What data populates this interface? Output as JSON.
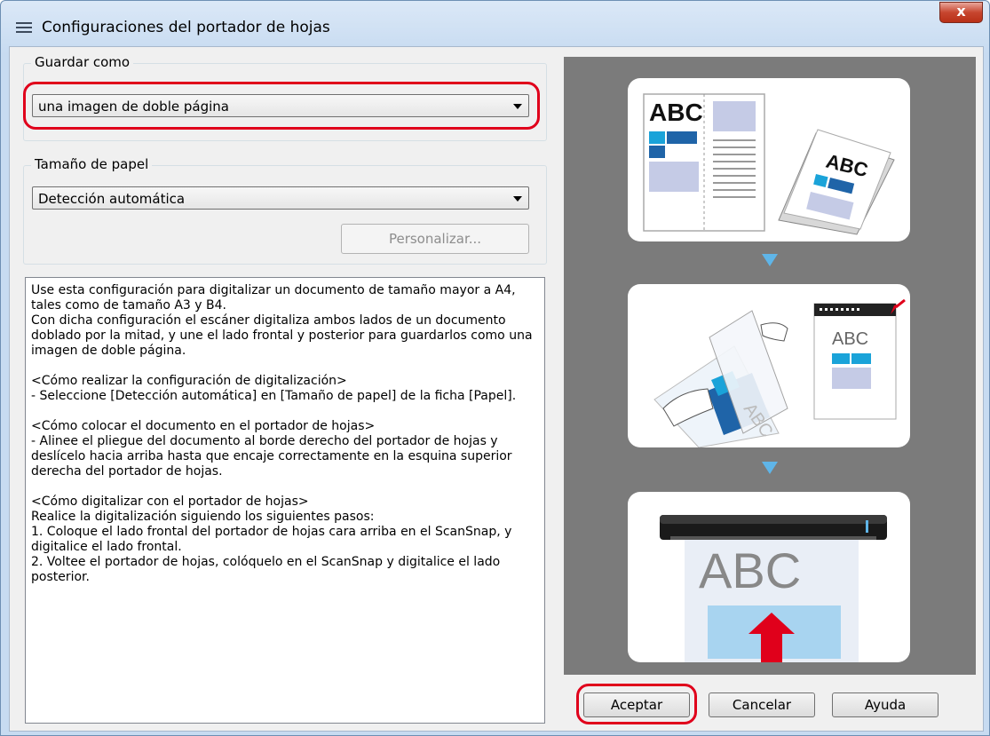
{
  "window": {
    "title": "Configuraciones del portador de hojas",
    "close_label": "x"
  },
  "save_as": {
    "label": "Guardar como",
    "selected": "una imagen de doble página"
  },
  "paper_size": {
    "label": "Tamaño de papel",
    "selected": "Detección automática",
    "customize_label": "Personalizar..."
  },
  "description": "Use esta configuración para digitalizar un documento de tamaño mayor a A4, tales como de tamaño A3 y B4.\nCon dicha configuración el escáner digitaliza ambos lados de un documento doblado por la mitad, y une el lado frontal y posterior para guardarlos como una imagen de doble página.\n\n<Cómo realizar la configuración de digitalización>\n- Seleccione [Detección automática] en [Tamaño de papel] de la ficha [Papel].\n\n<Cómo colocar el documento en el portador de hojas>\n- Alinee el pliegue del documento al borde derecho del portador de hojas y deslícelo hacia arriba hasta que encaje correctamente en la esquina superior derecha del portador de hojas.\n\n<Cómo digitalizar con el portador de hojas>\nRealice la digitalización siguiendo los siguientes pasos:\n1. Coloque el lado frontal del portador de hojas cara arriba en el ScanSnap, y digitalice el lado frontal.\n2. Voltee el portador de hojas, colóquelo en el ScanSnap y digitalice el lado posterior.",
  "illustration": {
    "step1_text_a": "ABC",
    "step1_text_b": "ABC",
    "step2_text": "ABC",
    "step3_text": "ABC"
  },
  "buttons": {
    "ok": "Aceptar",
    "cancel": "Cancelar",
    "help": "Ayuda"
  },
  "colors": {
    "highlight": "#e0001b",
    "accent_blue": "#1aa3d9",
    "dark_blue": "#1f64a8",
    "arrow_blue": "#5fb5e8",
    "panel_gray": "#7b7b7b"
  }
}
